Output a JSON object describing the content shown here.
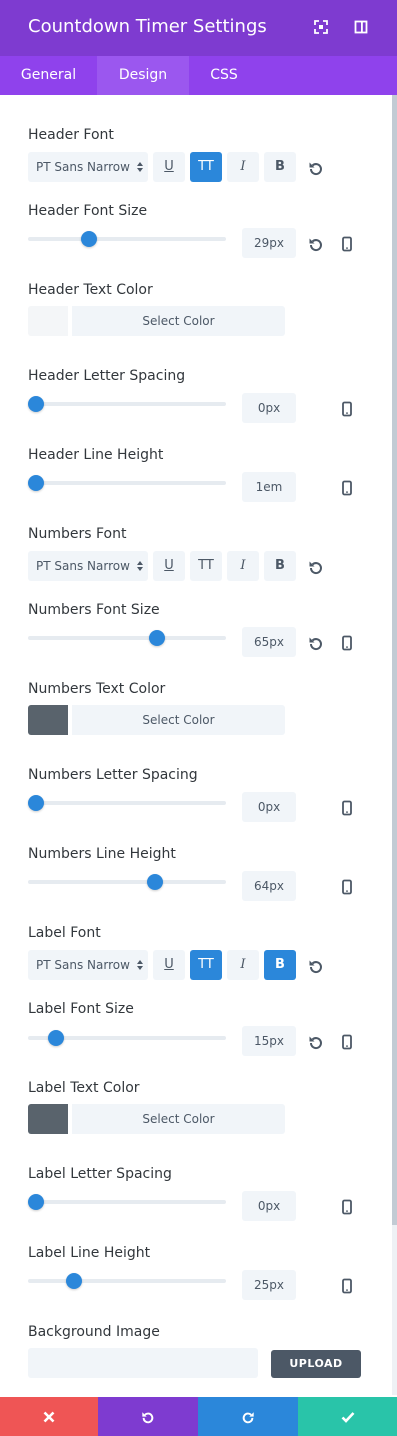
{
  "window": {
    "title": "Countdown Timer Settings",
    "expand_icon": "expand-icon",
    "sidebar_icon": "sidebar-toggle-icon"
  },
  "tabs": [
    {
      "label": "General",
      "active": false
    },
    {
      "label": "Design",
      "active": true
    },
    {
      "label": "CSS",
      "active": false
    }
  ],
  "header_font": {
    "label": "Header Font",
    "font_value": "PT Sans Narrow",
    "style_buttons": [
      {
        "label": "U",
        "style": "underline",
        "active": false
      },
      {
        "label": "TT",
        "style": "uppercase",
        "active": true
      },
      {
        "label": "I",
        "style": "italic",
        "active": false
      },
      {
        "label": "B",
        "style": "bold",
        "active": false
      }
    ]
  },
  "header_font_size": {
    "label": "Header Font Size",
    "value": "29px",
    "slider_level": 0.31
  },
  "header_text_color": {
    "label": "Header Text Color",
    "button": "Select Color",
    "swatch_color": "#f4f6f8"
  },
  "header_letter_spacing": {
    "label": "Header Letter Spacing",
    "value": "0px",
    "slider_level": 0.0
  },
  "header_line_height": {
    "label": "Header Line Height",
    "value": "1em",
    "slider_level": 0.0
  },
  "numbers_font": {
    "label": "Numbers Font",
    "font_value": "PT Sans Narrow",
    "style_buttons": [
      {
        "label": "U",
        "style": "underline",
        "active": false
      },
      {
        "label": "TT",
        "style": "uppercase",
        "active": false
      },
      {
        "label": "I",
        "style": "italic",
        "active": false
      },
      {
        "label": "B",
        "style": "bold",
        "active": false
      }
    ]
  },
  "numbers_font_size": {
    "label": "Numbers Font Size",
    "value": "65px",
    "slider_level": 0.65
  },
  "numbers_text_color": {
    "label": "Numbers Text Color",
    "button": "Select Color",
    "swatch_color": "#59636c"
  },
  "numbers_letter_spacing": {
    "label": "Numbers Letter Spacing",
    "value": "0px",
    "slider_level": 0.0
  },
  "numbers_line_height": {
    "label": "Numbers Line Height",
    "value": "64px",
    "slider_level": 0.64
  },
  "label_font": {
    "label": "Label Font",
    "font_value": "PT Sans Narrow",
    "style_buttons": [
      {
        "label": "U",
        "style": "underline",
        "active": false
      },
      {
        "label": "TT",
        "style": "uppercase",
        "active": true
      },
      {
        "label": "I",
        "style": "italic",
        "active": false
      },
      {
        "label": "B",
        "style": "bold",
        "active": true
      }
    ]
  },
  "label_font_size": {
    "label": "Label Font Size",
    "value": "15px",
    "slider_level": 0.14
  },
  "label_text_color": {
    "label": "Label Text Color",
    "button": "Select Color",
    "swatch_color": "#59636c"
  },
  "label_letter_spacing": {
    "label": "Label Letter Spacing",
    "value": "0px",
    "slider_level": 0.0
  },
  "label_line_height": {
    "label": "Label Line Height",
    "value": "25px",
    "slider_level": 0.23
  },
  "background_image": {
    "label": "Background Image",
    "value": "",
    "upload_label": "UPLOAD"
  },
  "footer": [
    {
      "name": "discard",
      "icon": "close-icon",
      "color": "#ef5555"
    },
    {
      "name": "undo",
      "icon": "undo-icon",
      "color": "#7e3bd0"
    },
    {
      "name": "redo",
      "icon": "redo-icon",
      "color": "#2b87da"
    },
    {
      "name": "save",
      "icon": "check-icon",
      "color": "#29c4a9"
    }
  ],
  "colors": {
    "header_bg": "#7e3bd0",
    "tabs_bg": "#8f42ec",
    "active_tab_bg": "#9b57ef",
    "accent": "#2b87da",
    "field_bg": "#f1f5f9",
    "upload_bg": "#4c5866"
  }
}
